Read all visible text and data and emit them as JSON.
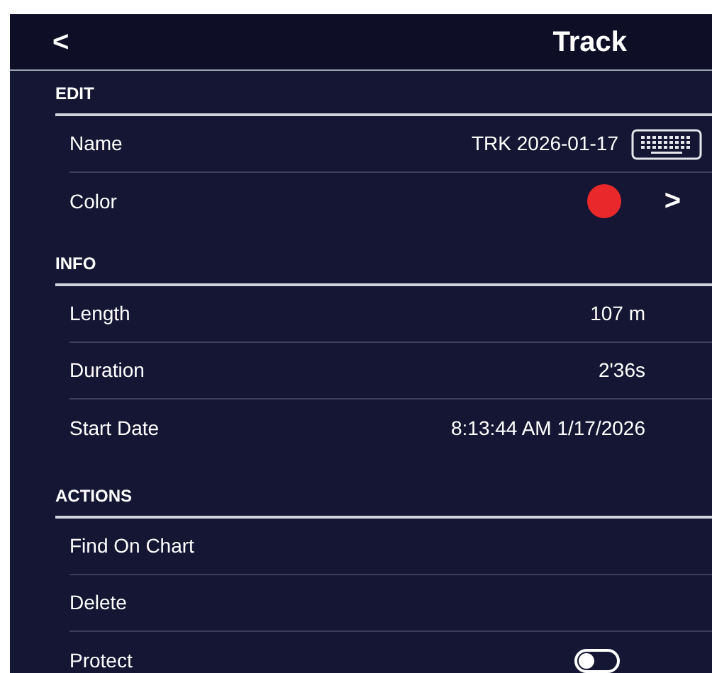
{
  "header": {
    "back": "<",
    "title": "Track"
  },
  "sections": [
    {
      "title": "EDIT",
      "rows": [
        {
          "kind": "keyboard",
          "label": "Name",
          "value": "TRK 2026-01-17"
        },
        {
          "kind": "color",
          "label": "Color",
          "color": "#e8282b",
          "chevron": ">"
        }
      ]
    },
    {
      "title": "INFO",
      "rows": [
        {
          "kind": "text",
          "label": "Length",
          "value": "107 m"
        },
        {
          "kind": "text",
          "label": "Duration",
          "value": "2'36s"
        },
        {
          "kind": "text",
          "label": "Start Date",
          "value": "8:13:44 AM 1/17/2026"
        }
      ]
    },
    {
      "title": "ACTIONS",
      "rows": [
        {
          "kind": "action",
          "label": "Find On Chart"
        },
        {
          "kind": "action",
          "label": "Delete"
        },
        {
          "kind": "toggle",
          "label": "Protect",
          "on": false
        }
      ]
    }
  ]
}
